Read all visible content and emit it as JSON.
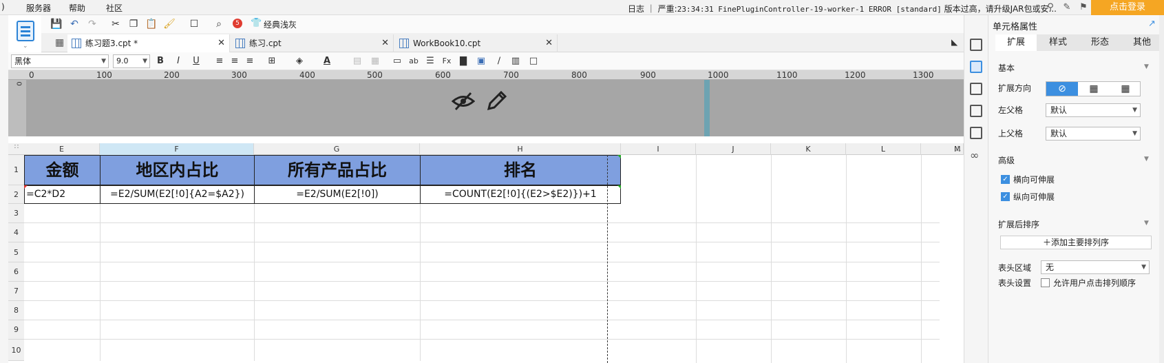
{
  "menu": {
    "items": [
      "服务器",
      "帮助",
      "社区"
    ]
  },
  "status": {
    "log_label": "日志",
    "log_message_prefix": "｜ 严重:",
    "log_message_mono": "23:34:31 FinePluginController-19-worker-1 ERROR [standard]",
    "log_message_suffix": "版本过高，请升级JAR包或安..."
  },
  "login": {
    "label": "点击登录"
  },
  "toolbar": {
    "badge_count": "5",
    "classic_label": "经典浅灰"
  },
  "tabs": [
    {
      "label": "练习题3.cpt *"
    },
    {
      "label": "练习.cpt"
    },
    {
      "label": "WorkBook10.cpt"
    }
  ],
  "format": {
    "font": "黑体",
    "size": "9.0",
    "bold": "B",
    "italic": "I",
    "underline": "U"
  },
  "ruler": {
    "marks": [
      "0",
      "100",
      "200",
      "300",
      "400",
      "500",
      "600",
      "700",
      "800",
      "900",
      "1000",
      "1100",
      "1200",
      "1300"
    ],
    "band_zero": "0"
  },
  "sheet": {
    "columns": [
      "E",
      "F",
      "G",
      "H",
      "I",
      "J",
      "K",
      "L",
      "M"
    ],
    "rows": [
      "1",
      "2",
      "3",
      "4",
      "5",
      "6",
      "7",
      "8",
      "9",
      "10"
    ],
    "headers": [
      "金额",
      "地区内占比",
      "所有产品占比",
      "排名"
    ],
    "formulas": [
      "=C2*D2",
      "=E2/SUM(E2[!0]{A2=$A2})",
      "=E2/SUM(E2[!0])",
      "=COUNT(E2[!0]{(E2>$E2)})+1"
    ]
  },
  "panel": {
    "title": "单元格属性",
    "tabs": [
      "扩展",
      "样式",
      "形态",
      "其他"
    ],
    "basic_title": "基本",
    "expand_direction_label": "扩展方向",
    "left_parent_label": "左父格",
    "left_parent_value": "默认",
    "top_parent_label": "上父格",
    "top_parent_value": "默认",
    "advanced_title": "高级",
    "horizontal_expand_label": "横向可伸展",
    "vertical_expand_label": "纵向可伸展",
    "sort_title": "扩展后排序",
    "add_sort_label": "添加主要排列序",
    "header_area_label": "表头区域",
    "header_area_value": "无",
    "header_settings_label": "表头设置",
    "allow_sort_label": "允许用户点击排列顺序"
  },
  "colors": {
    "header_fill": "#7f9fdf",
    "login_bg": "#f5a623",
    "accent": "#3c8fe0"
  }
}
